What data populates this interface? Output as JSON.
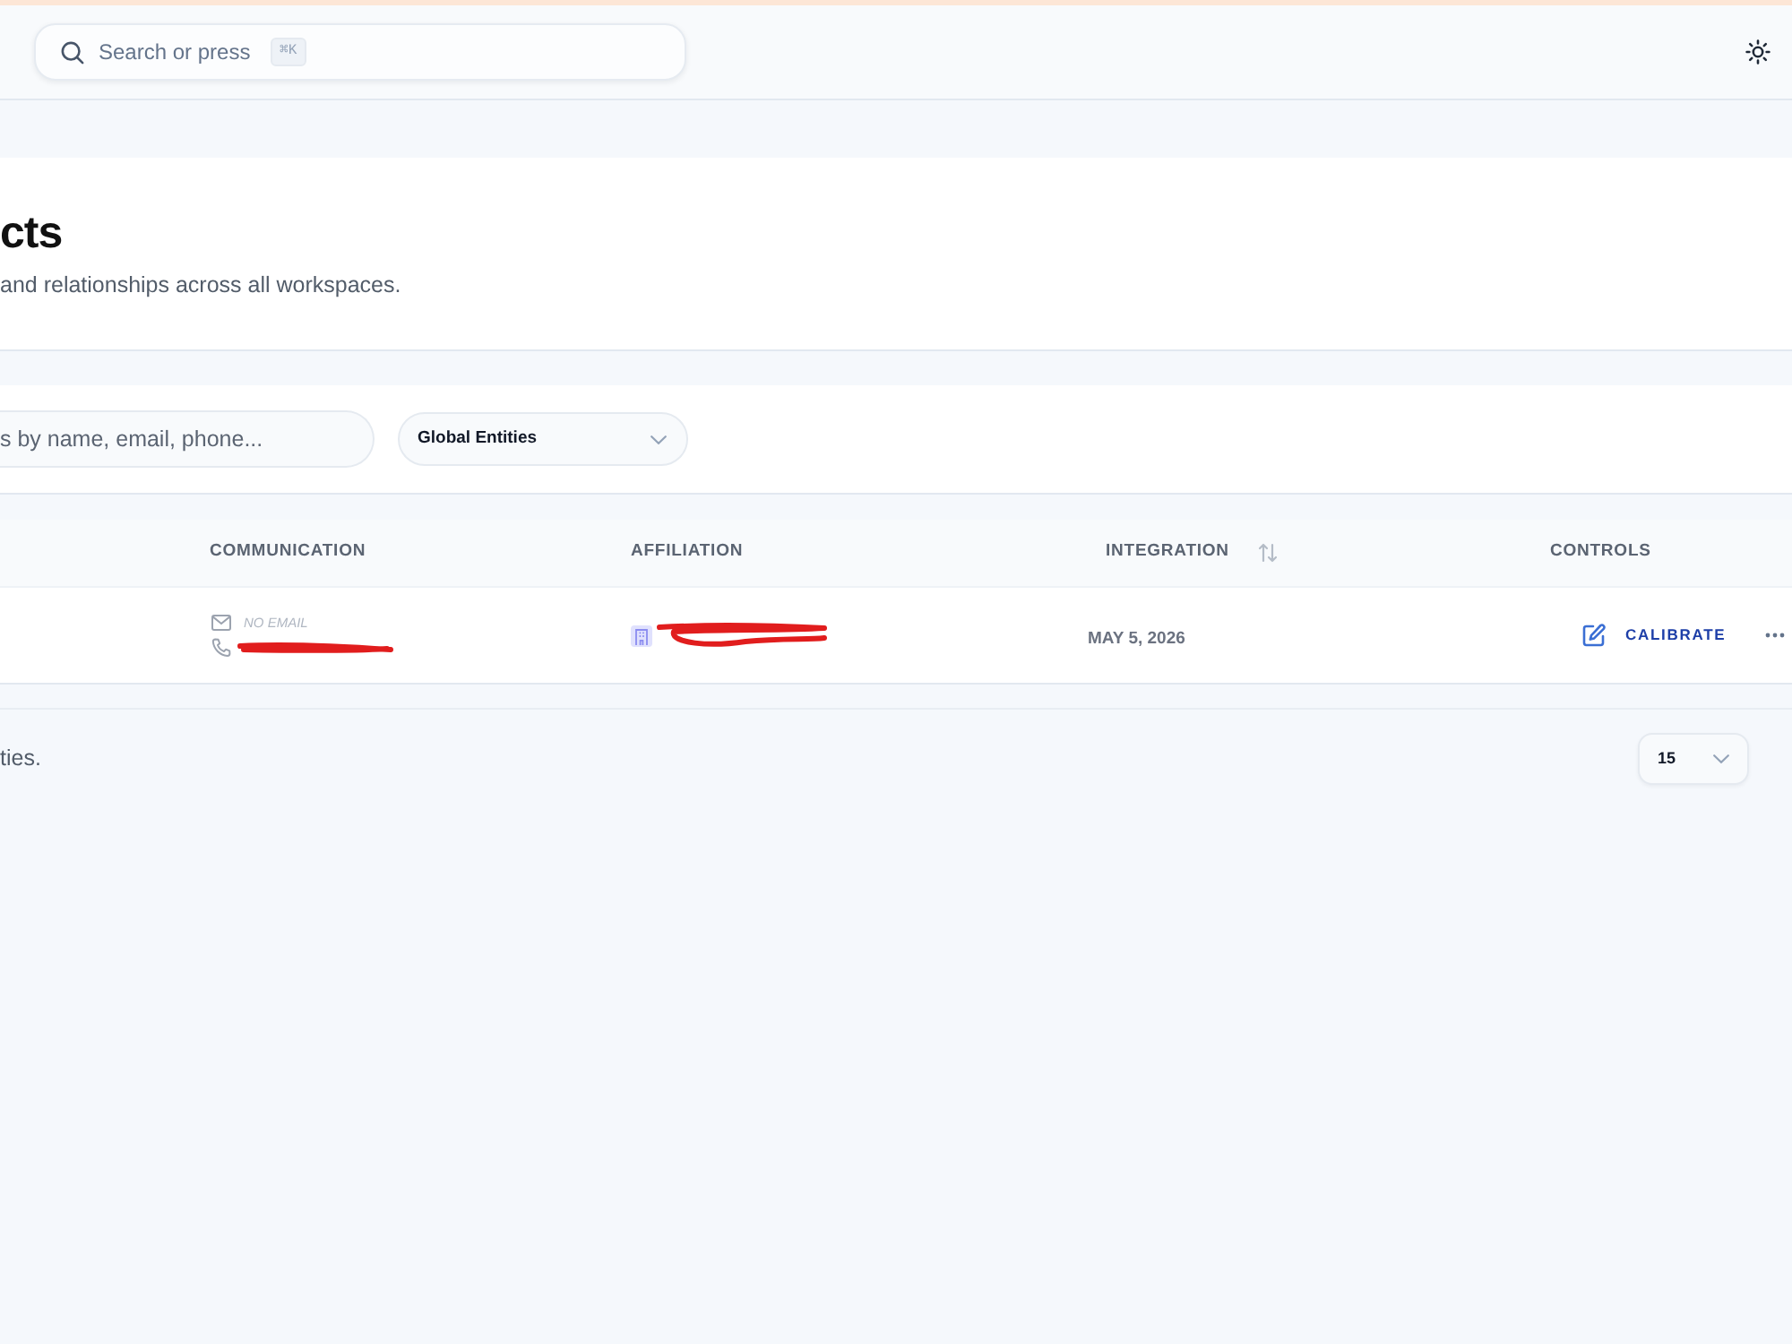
{
  "top_bar": {
    "search": {
      "placeholder": "Search or press",
      "shortcut": "⌘K"
    }
  },
  "page_header": {
    "title": "cts",
    "subtitle": "and relationships across all workspaces."
  },
  "filters": {
    "search": {
      "placeholder": "s by name, email, phone..."
    },
    "scope_select": {
      "value": "Global Entities"
    }
  },
  "table": {
    "columns": [
      {
        "label": "COMMUNICATION",
        "sortable": false
      },
      {
        "label": "AFFILIATION",
        "sortable": false
      },
      {
        "label": "INTEGRATION",
        "sortable": true
      },
      {
        "label": "CONTROLS",
        "sortable": false
      }
    ],
    "rows": [
      {
        "email": "NO EMAIL",
        "phone": {
          "redacted": true
        },
        "affiliation": {
          "redacted": true
        },
        "date": "MAY 5, 2026",
        "action": "CALIBRATE"
      }
    ]
  },
  "footer": {
    "summary": "ties.",
    "page_size": "15"
  }
}
